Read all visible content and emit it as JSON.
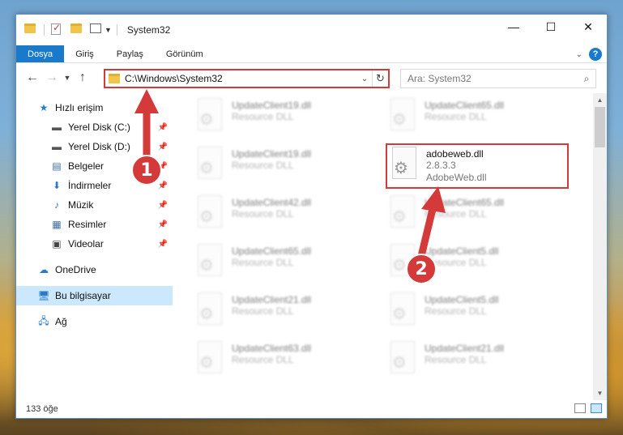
{
  "window": {
    "title": "System32",
    "controls": {
      "minimize": "—",
      "maximize": "☐",
      "close": "✕"
    }
  },
  "ribbon": {
    "tabs": [
      "Dosya",
      "Giriş",
      "Paylaş",
      "Görünüm"
    ],
    "help": "?"
  },
  "address": {
    "path": "C:\\Windows\\System32",
    "search_placeholder": "Ara: System32"
  },
  "sidebar": {
    "quick_access": "Hızlı erişim",
    "items": [
      {
        "label": "Yerel Disk (C:)",
        "icon": "drive-icon"
      },
      {
        "label": "Yerel Disk (D:)",
        "icon": "drive-icon"
      },
      {
        "label": "Belgeler",
        "icon": "documents-icon"
      },
      {
        "label": "İndirmeler",
        "icon": "download-icon"
      },
      {
        "label": "Müzik",
        "icon": "music-icon"
      },
      {
        "label": "Resimler",
        "icon": "pictures-icon"
      },
      {
        "label": "Videolar",
        "icon": "videos-icon"
      }
    ],
    "onedrive": "OneDrive",
    "this_pc": "Bu bilgisayar",
    "network": "Ağ"
  },
  "files": {
    "left_column": [
      {
        "name": "UpdateClient19.dll",
        "type": "Resource DLL"
      },
      {
        "name": "UpdateClient19.dll",
        "type": "Resource DLL"
      },
      {
        "name": "UpdateClient42.dll",
        "type": "Resource DLL"
      },
      {
        "name": "UpdateClient65.dll",
        "type": "Resource DLL"
      },
      {
        "name": "UpdateClient21.dll",
        "type": "Resource DLL"
      },
      {
        "name": "UpdateClient63.dll",
        "type": "Resource DLL"
      }
    ],
    "right_column": [
      {
        "name": "UpdateClient65.dll",
        "type": "Resource DLL"
      },
      {
        "name": "UpdateClient65.dll",
        "type": "Resource DLL"
      },
      {
        "name": "UpdateClient5.dll",
        "type": "Resource DLL"
      },
      {
        "name": "UpdateClient5.dll",
        "type": "Resource DLL"
      },
      {
        "name": "UpdateClient21.dll",
        "type": "Resource DLL"
      }
    ],
    "highlighted": {
      "name": "adobeweb.dll",
      "version": "2.8.3.3",
      "description": "AdobeWeb.dll"
    }
  },
  "status": {
    "item_count": "133 öğe"
  },
  "callouts": {
    "one": "1",
    "two": "2"
  },
  "colors": {
    "accent": "#1979ca",
    "highlight": "#d43a3a",
    "selected": "#cce8ff"
  }
}
